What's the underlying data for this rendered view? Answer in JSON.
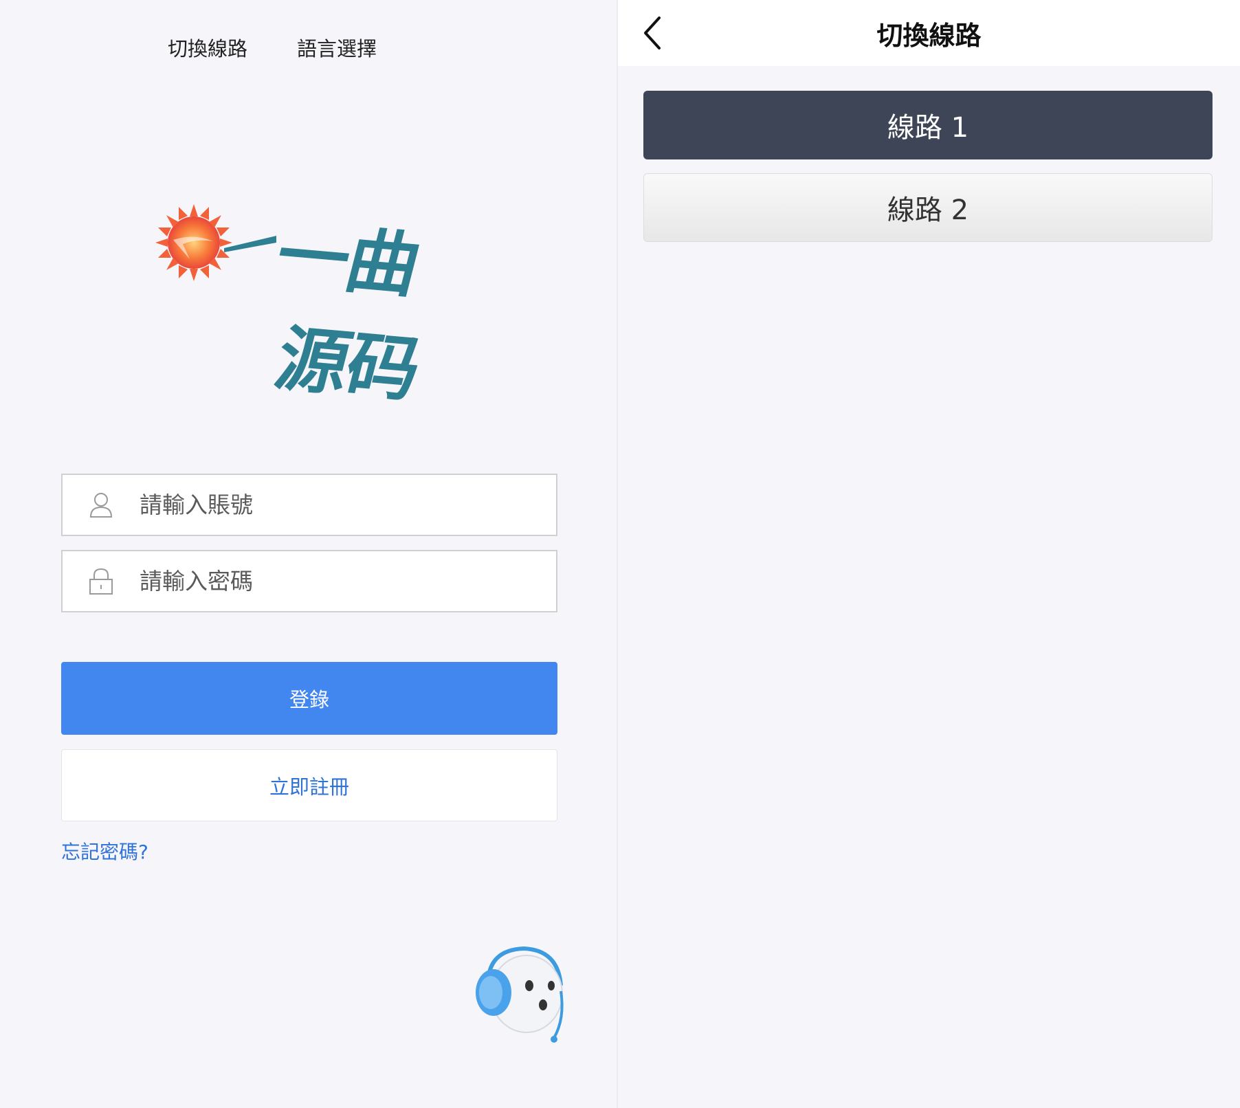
{
  "login_page": {
    "top_links": {
      "switch_line": "切換線路",
      "language": "語言選擇"
    },
    "logo_text": "一曲源码",
    "account": {
      "placeholder": "請輸入賬號",
      "value": ""
    },
    "password": {
      "placeholder": "請輸入密碼",
      "value": ""
    },
    "login_button": "登錄",
    "register_button": "立即註冊",
    "forgot_password": "忘記密碼?",
    "icons": {
      "account": "user-icon",
      "password": "lock-icon",
      "support": "customer-support-icon",
      "logo": "sun-logo-icon"
    }
  },
  "line_page": {
    "title": "切換線路",
    "back_icon": "chevron-left-icon",
    "lines": [
      {
        "label": "線路 1",
        "selected": true
      },
      {
        "label": "線路 2",
        "selected": false
      }
    ]
  },
  "colors": {
    "primary": "#4286ef",
    "link": "#2f73d9",
    "selected_line": "#3e4557",
    "logo_text": "#2f7f93",
    "background": "#f6f6fa"
  }
}
